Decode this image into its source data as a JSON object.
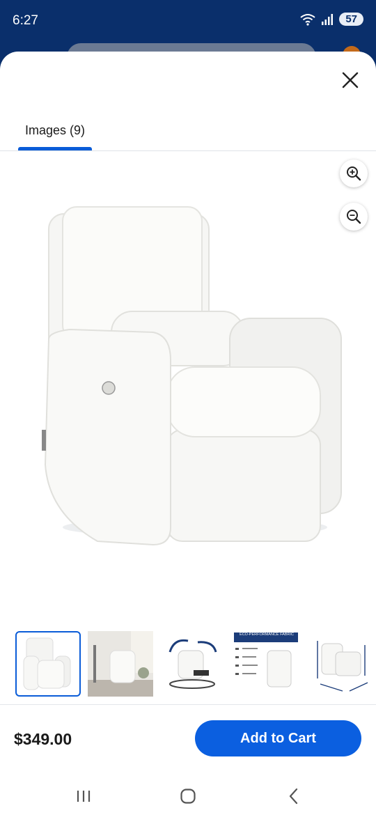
{
  "status_bar": {
    "time": "6:27",
    "battery": "57"
  },
  "modal": {
    "tabs": [
      {
        "label": "Images (9)",
        "selected": true
      }
    ],
    "thumbnails": [
      {
        "name": "thumb-1",
        "selected": true
      },
      {
        "name": "thumb-2",
        "selected": false
      },
      {
        "name": "thumb-3",
        "selected": false
      },
      {
        "name": "thumb-4",
        "selected": false,
        "text": "ECO-PERFORMANCE FABRIC"
      },
      {
        "name": "thumb-5",
        "selected": false
      }
    ]
  },
  "footer": {
    "price": "$349.00",
    "add_to_cart_label": "Add to Cart"
  },
  "colors": {
    "accent": "#0b5fe0",
    "status_bar_bg": "#0a2f6b"
  },
  "icons": [
    "wifi-icon",
    "signal-icon",
    "close-icon",
    "zoom-in-icon",
    "zoom-out-icon",
    "recent-apps-icon",
    "home-icon",
    "back-icon"
  ]
}
